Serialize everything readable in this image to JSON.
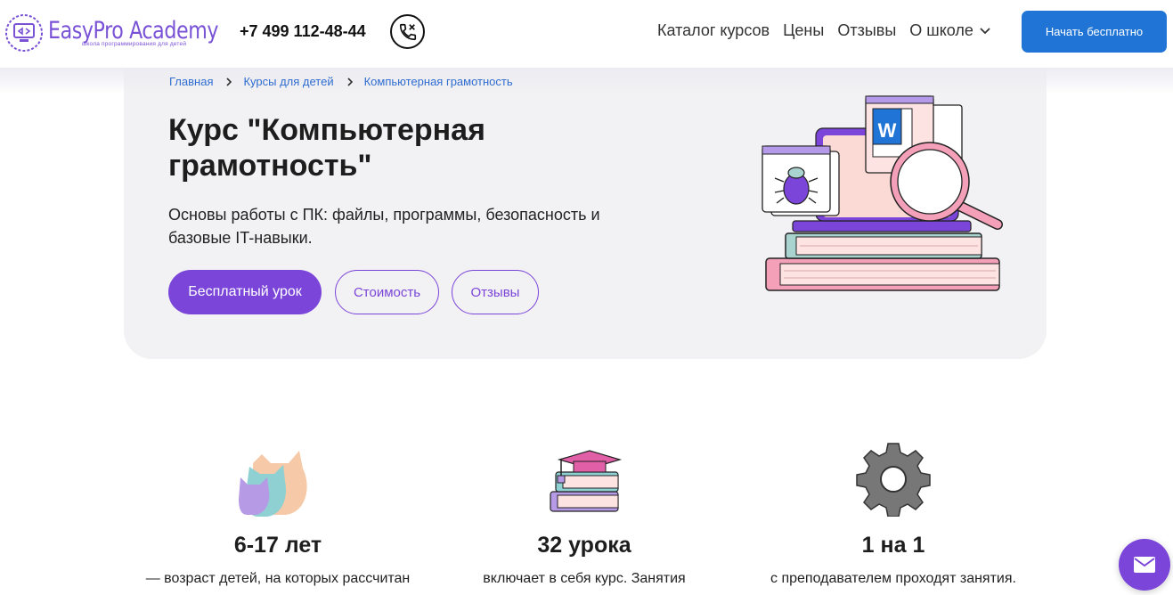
{
  "header": {
    "logo_name": "EasyPro Academy",
    "logo_tagline": "школа программирования для детей",
    "phone": "+7 499 112-48-44",
    "nav": [
      "Каталог курсов",
      "Цены",
      "Отзывы",
      "О школе"
    ],
    "cta_label": "Начать бесплатно"
  },
  "breadcrumb": [
    "Главная",
    "Курсы для детей",
    "Компьютерная грамотность"
  ],
  "hero": {
    "title": "Курс \"Компьютерная грамотность\"",
    "subtitle": "Основы работы с ПК: файлы, программы, безопасность и базовые IT-навыки.",
    "primary_button": "Бесплатный урок",
    "price_button": "Стоимость",
    "reviews_button": "Отзывы"
  },
  "features": [
    {
      "icon": "cats-icon",
      "value": "6-17 лет",
      "desc": "— возраст детей, на которых рассчитан"
    },
    {
      "icon": "books-icon",
      "value": "32 урока",
      "desc": "включает в себя курс. Занятия"
    },
    {
      "icon": "gear-icon",
      "value": "1 на 1",
      "desc": "с преподавателем проходят занятия."
    }
  ],
  "colors": {
    "accent": "#7b45d9",
    "blue": "#1f74d6",
    "hero_bg": "#f2f1f3"
  }
}
